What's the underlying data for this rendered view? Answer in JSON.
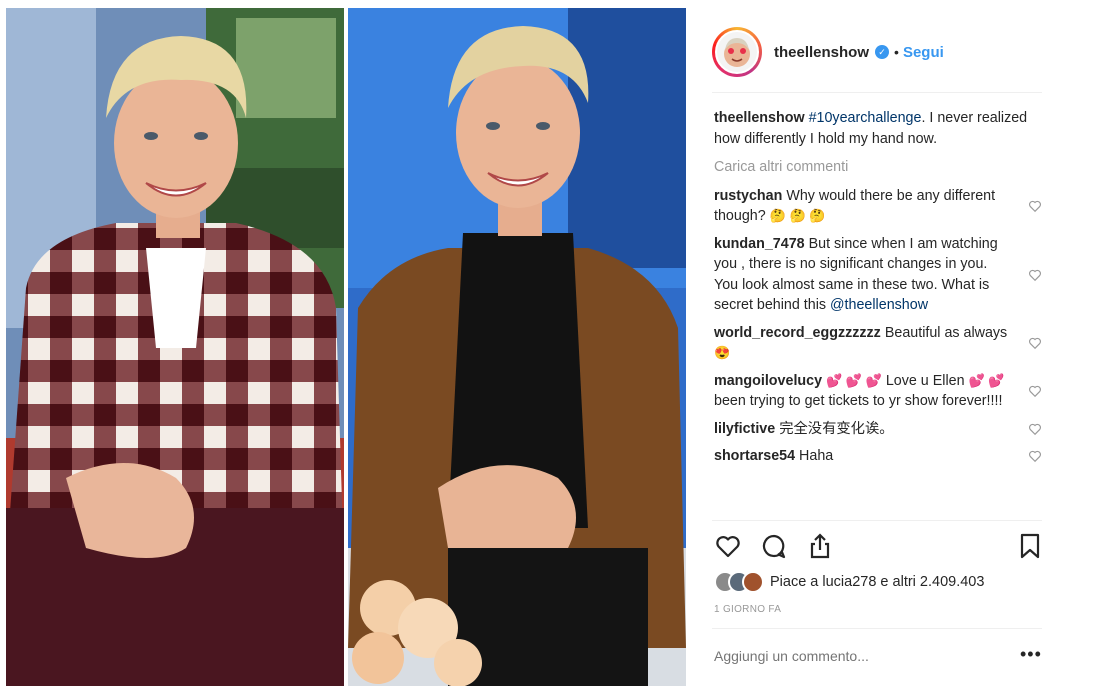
{
  "post": {
    "username": "theellenshow",
    "verified_mark": "✓",
    "dot": "•",
    "follow_label": "Segui",
    "caption": {
      "username": "theellenshow",
      "hashtag": "#10yearchallenge",
      "text": ". I never realized how differently I hold my hand now."
    },
    "load_more_label": "Carica altri commenti",
    "comments": [
      {
        "user": "rustychan",
        "text": "Why would there be any different though?",
        "emoji": "🤔 🤔 🤔"
      },
      {
        "user": "kundan_7478",
        "text": "But since when I am watching you , there is no significant changes in you. You look almost same in these two. What is secret behind this",
        "mention": "@theellenshow"
      },
      {
        "user": "world_record_eggzzzzzz",
        "text": "Beautiful as always",
        "emoji": "😍"
      },
      {
        "user": "mangoilovelucy",
        "emoji_lead": "💕 💕 💕",
        "text": "Love u Ellen",
        "emoji_mid": "💕 💕",
        "text2": "been trying to get tickets to yr show forever!!!!"
      },
      {
        "user": "lilyfictive",
        "text": "完全没有变化诶。"
      },
      {
        "user": "shortarse54",
        "text": "Haha"
      }
    ],
    "likes_text": "Piace a lucia278 e altri 2.409.403",
    "timestamp": "1 GIORNO FA",
    "add_comment_placeholder": "Aggiungi un commento...",
    "more_label": "•••"
  },
  "icons": {
    "like": "heart-icon",
    "comment": "comment-bubble-icon",
    "share": "share-icon",
    "save": "bookmark-icon"
  },
  "colors": {
    "link_blue": "#3897f0",
    "hashtag_blue": "#003569",
    "muted_gray": "#999999",
    "text": "#262626"
  }
}
